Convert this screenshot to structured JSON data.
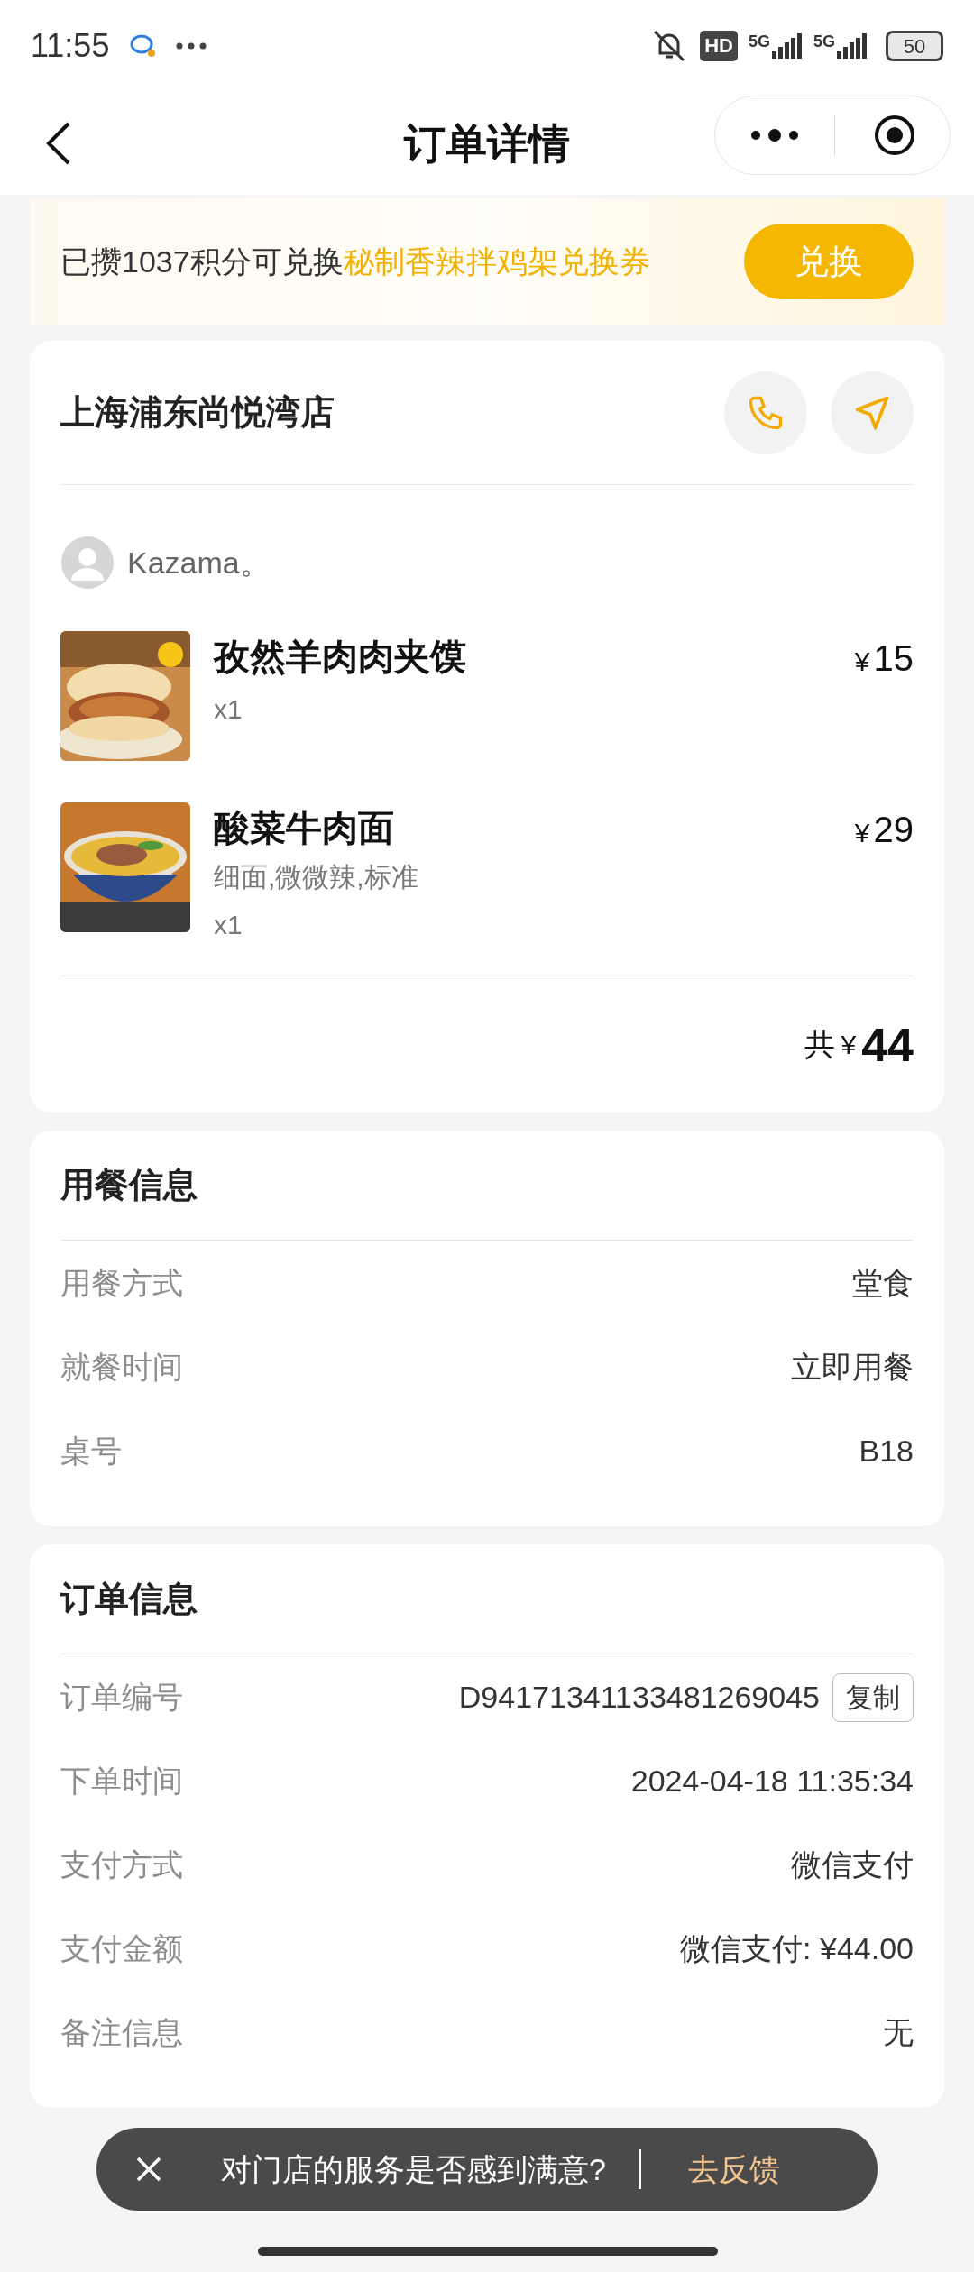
{
  "status_bar": {
    "time": "11:55",
    "network": [
      "5G",
      "5G"
    ],
    "hd": "HD",
    "battery": "50"
  },
  "header": {
    "title": "订单详情"
  },
  "banner": {
    "text": "已攒1037积分可兑换",
    "highlight": "秘制香辣拌鸡架兑换券",
    "button": "兑换"
  },
  "store": {
    "name": "上海浦东尚悦湾店",
    "user": "Kazama。",
    "items": [
      {
        "name": "孜然羊肉肉夹馍",
        "qty": "x1",
        "currency": "¥",
        "price": "15",
        "kind": "bun"
      },
      {
        "name": "酸菜牛肉面",
        "options": "细面,微微辣,标准",
        "qty": "x1",
        "currency": "¥",
        "price": "29",
        "kind": "noodle"
      }
    ],
    "total_label": "共",
    "total_currency": "¥",
    "total": "44"
  },
  "dining_info": {
    "title": "用餐信息",
    "rows": [
      {
        "label": "用餐方式",
        "value": "堂食"
      },
      {
        "label": "就餐时间",
        "value": "立即用餐"
      },
      {
        "label": "桌号",
        "value": "B18"
      }
    ]
  },
  "order_info": {
    "title": "订单信息",
    "rows": [
      {
        "label": "订单编号",
        "value": "D94171341133481269045",
        "action": "复制"
      },
      {
        "label": "下单时间",
        "value": "2024-04-18 11:35:34"
      },
      {
        "label": "支付方式",
        "value": "微信支付"
      },
      {
        "label": "支付金额",
        "value": "微信支付: ¥44.00"
      },
      {
        "label": "备注信息",
        "value": "无"
      }
    ]
  },
  "toast": {
    "text": "对门店的服务是否感到满意?",
    "action": "去反馈"
  }
}
